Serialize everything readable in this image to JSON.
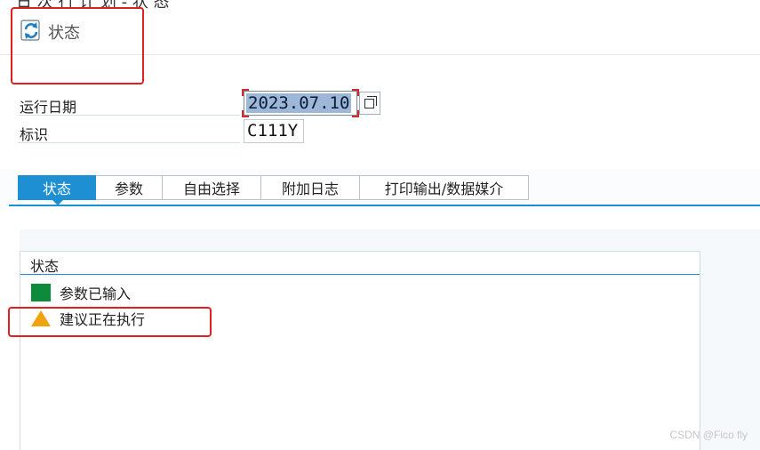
{
  "window": {
    "title_fragment": "日 次 行 计 划 - 状 态"
  },
  "toolbar": {
    "status_button_label": "状态",
    "status_icon": "refresh-icon"
  },
  "fields": {
    "run_date_label": "运行日期",
    "run_date_value": "2023.07.10",
    "identifier_label": "标识",
    "identifier_value": "C111Y"
  },
  "tabs": [
    {
      "label": "状态",
      "active": true
    },
    {
      "label": "参数",
      "active": false
    },
    {
      "label": "自由选择",
      "active": false
    },
    {
      "label": "附加日志",
      "active": false
    },
    {
      "label": "打印输出/数据媒介",
      "active": false
    }
  ],
  "status_panel": {
    "header": "状态",
    "items": [
      {
        "text": "参数已输入",
        "icon": "green-square-icon",
        "color": "#0e8a3c"
      },
      {
        "text": "建议正在执行",
        "icon": "warning-triangle-icon",
        "color": "#f2a20c"
      }
    ]
  },
  "colors": {
    "accent": "#1d8fd2",
    "annotation": "#e02020"
  },
  "watermark": "CSDN @Fico fly"
}
